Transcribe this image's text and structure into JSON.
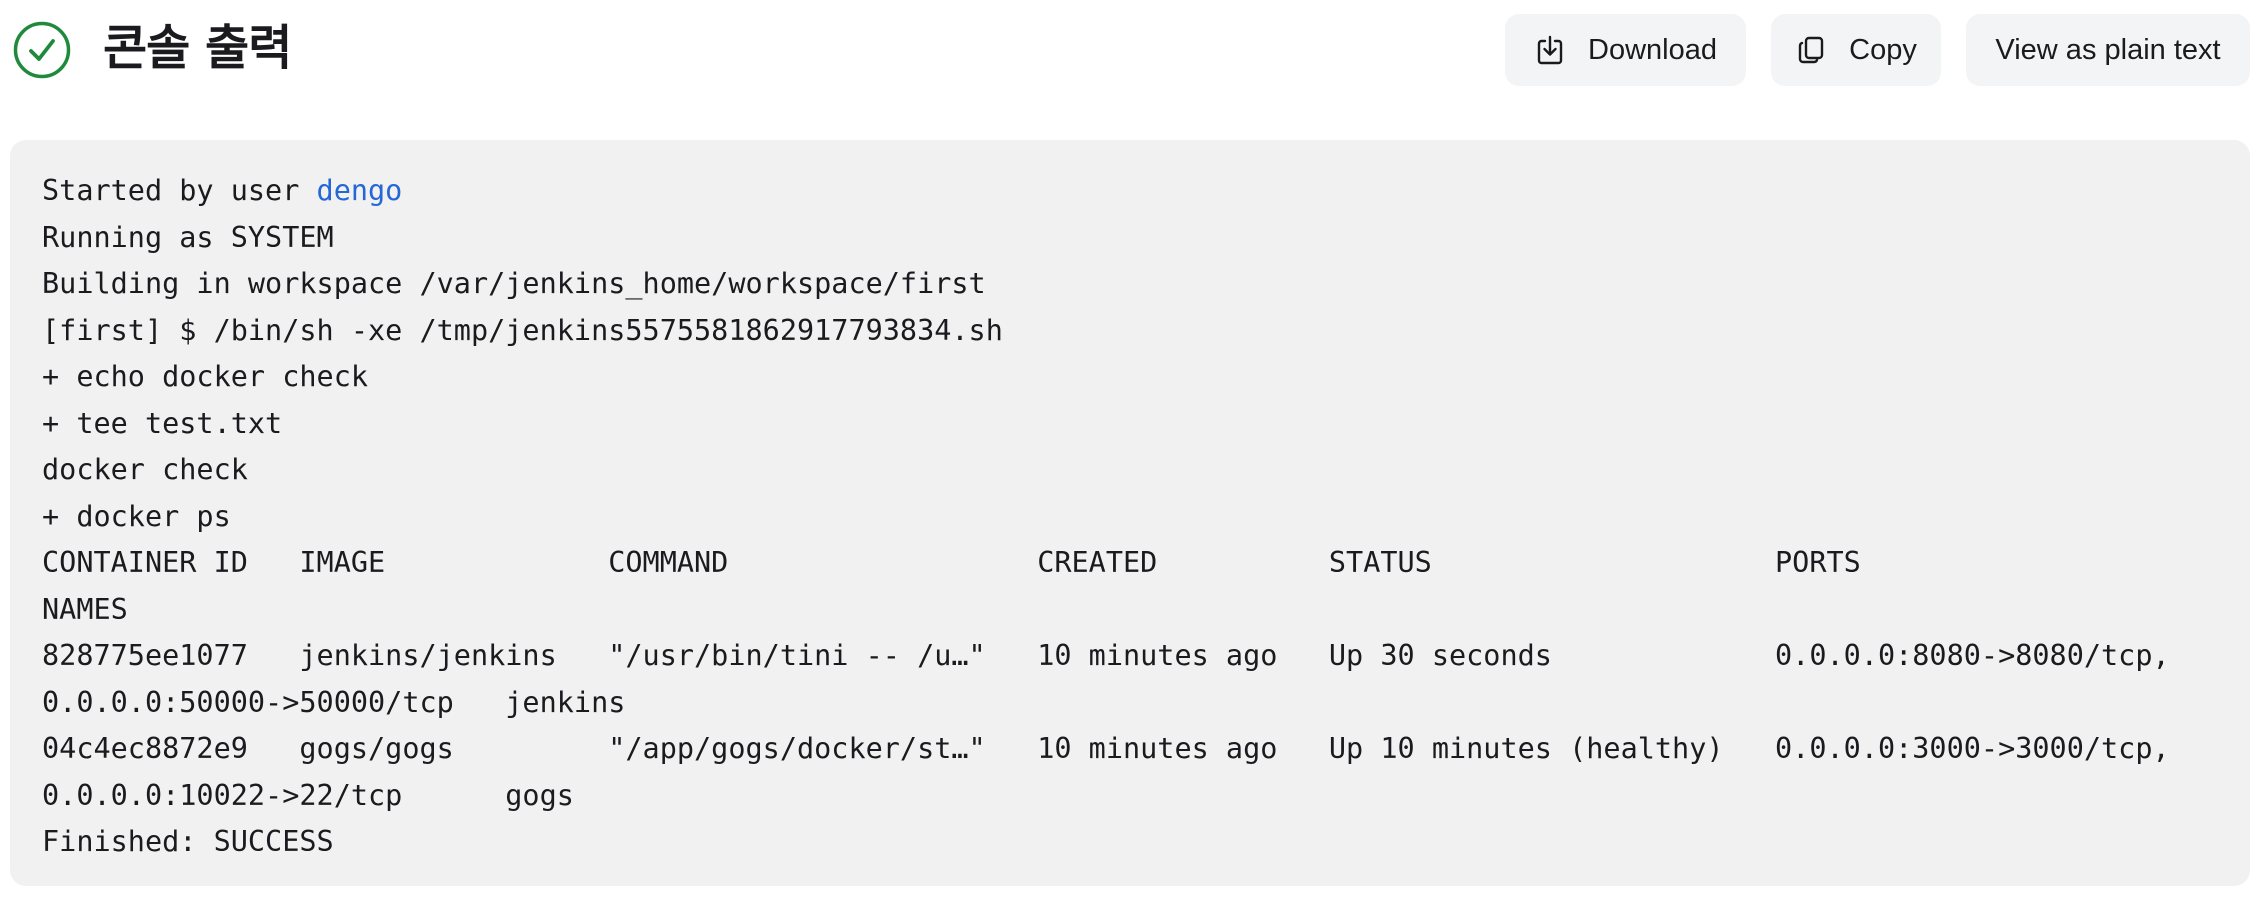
{
  "header": {
    "title": "콘솔 출력",
    "status_icon": "check-circle-icon",
    "status_color": "#1f8a3c"
  },
  "toolbar": {
    "download_label": "Download",
    "download_icon": "download-icon",
    "copy_label": "Copy",
    "copy_icon": "copy-icon",
    "plain_label": "View as plain text"
  },
  "console": {
    "started_prefix": "Started by user ",
    "user": "dengo",
    "link_color": "#2467d6",
    "lines": [
      "Running as SYSTEM",
      "Building in workspace /var/jenkins_home/workspace/first",
      "[first] $ /bin/sh -xe /tmp/jenkins5575581862917793834.sh",
      "+ echo docker check",
      "+ tee test.txt",
      "docker check",
      "+ docker ps",
      "CONTAINER ID   IMAGE             COMMAND                  CREATED          STATUS                    PORTS",
      "NAMES",
      "828775ee1077   jenkins/jenkins   \"/usr/bin/tini -- /u…\"   10 minutes ago   Up 30 seconds             0.0.0.0:8080->8080/tcp,",
      "0.0.0.0:50000->50000/tcp   jenkins",
      "04c4ec8872e9   gogs/gogs         \"/app/gogs/docker/st…\"   10 minutes ago   Up 10 minutes (healthy)   0.0.0.0:3000->3000/tcp,",
      "0.0.0.0:10022->22/tcp      gogs",
      "Finished: SUCCESS"
    ]
  }
}
